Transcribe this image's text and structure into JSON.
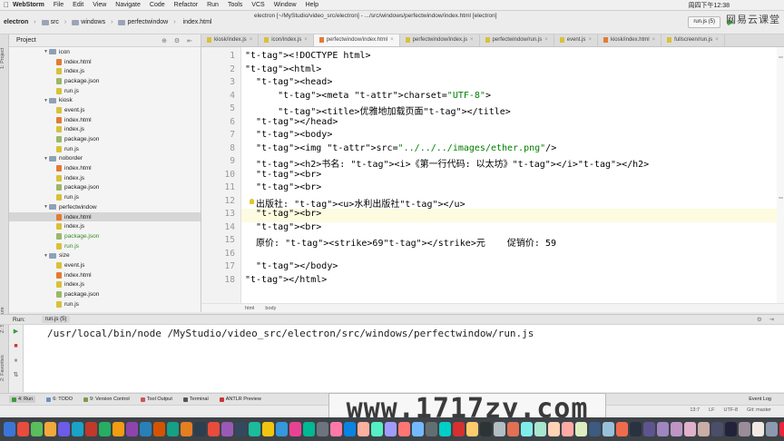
{
  "menubar": {
    "apple": "",
    "app_name": "WebStorm",
    "items": [
      "File",
      "Edit",
      "View",
      "Navigate",
      "Code",
      "Refactor",
      "Run",
      "Tools",
      "VCS",
      "Window",
      "Help"
    ],
    "clock": "周四下午12:38"
  },
  "window_title": "electron [~/MyStudio/video_src/electron] - .../src/windows/perfectwindow/index.html [electron]",
  "logo": "网易云课堂",
  "navbar": {
    "crumbs": [
      "electron",
      "src",
      "windows",
      "perfectwindow",
      "index.html"
    ],
    "run_config": "run.js (5)"
  },
  "left_strip": {
    "project": "1: Project",
    "structure": "Z: Structure",
    "favorites": "2: Favorites"
  },
  "project": {
    "title": "Project",
    "tree": [
      {
        "label": "icon",
        "kind": "folder"
      },
      {
        "label": "index.html",
        "kind": "html"
      },
      {
        "label": "index.js",
        "kind": "js"
      },
      {
        "label": "package.json",
        "kind": "json"
      },
      {
        "label": "run.js",
        "kind": "js"
      },
      {
        "label": "kiosk",
        "kind": "folder"
      },
      {
        "label": "event.js",
        "kind": "js"
      },
      {
        "label": "index.html",
        "kind": "html"
      },
      {
        "label": "index.js",
        "kind": "js"
      },
      {
        "label": "package.json",
        "kind": "json"
      },
      {
        "label": "run.js",
        "kind": "js"
      },
      {
        "label": "noborder",
        "kind": "folder"
      },
      {
        "label": "index.html",
        "kind": "html"
      },
      {
        "label": "index.js",
        "kind": "js"
      },
      {
        "label": "package.json",
        "kind": "json"
      },
      {
        "label": "run.js",
        "kind": "js"
      },
      {
        "label": "perfectwindow",
        "kind": "folder"
      },
      {
        "label": "index.html",
        "kind": "html",
        "selected": true
      },
      {
        "label": "index.js",
        "kind": "js"
      },
      {
        "label": "package.json",
        "kind": "json",
        "green": true
      },
      {
        "label": "run.js",
        "kind": "js",
        "green": true
      },
      {
        "label": "size",
        "kind": "folder"
      },
      {
        "label": "event.js",
        "kind": "js"
      },
      {
        "label": "index.html",
        "kind": "html"
      },
      {
        "label": "index.js",
        "kind": "js"
      },
      {
        "label": "package.json",
        "kind": "json"
      },
      {
        "label": "run.js",
        "kind": "js"
      }
    ]
  },
  "tabs": [
    {
      "label": "kiosk/index.js"
    },
    {
      "label": "icon/index.js"
    },
    {
      "label": "perfectwindow/index.html",
      "active": true
    },
    {
      "label": "perfectwindow/index.js"
    },
    {
      "label": "perfectwindow/run.js"
    },
    {
      "label": "event.js"
    },
    {
      "label": "kiosk/index.html"
    },
    {
      "label": "fullscreen/run.js"
    }
  ],
  "editor": {
    "line_numbers": [
      "1",
      "2",
      "3",
      "4",
      "5",
      "6",
      "7",
      "8",
      "9",
      "10",
      "11",
      "12",
      "13",
      "14",
      "15",
      "16",
      "17",
      "18"
    ],
    "lines": [
      "<!DOCTYPE html>",
      "<html>",
      "  <head>",
      "      <meta charset=\"UTF-8\">",
      "      <title>优雅地加载页面</title>",
      "  </head>",
      "  <body>",
      "  <img src=\"../../../images/ether.png\"/>",
      "  <h2>书名: <i>《第一行代码: 以太坊》</i></h2>",
      "  <br>",
      "  <br>",
      "  出版社: <u>水利出版社</u>",
      "  <br>",
      "  <br>",
      "  原价: <strike>69</strike>元    促销价: 59",
      "",
      "  </body>",
      "</html>"
    ],
    "breadcrumb": [
      "html",
      "body"
    ]
  },
  "run_panel": {
    "label": "Run:",
    "tab": "run.js (5)",
    "command": "/usr/local/bin/node /MyStudio/video_src/electron/src/windows/perfectwindow/run.js"
  },
  "toolwindows": [
    "4: Run",
    "6: TODO",
    "9: Version Control",
    "Tool Output",
    "Terminal",
    "ANTLR Preview"
  ],
  "event_log": "Event Log",
  "status": {
    "position": "13:7",
    "line_sep": "LF",
    "encoding": "UTF-8",
    "git": "Git: master"
  },
  "watermark": "www.1717zy.com",
  "colors": {
    "accent": "#3c9a3c",
    "html_icon": "#e37b34",
    "js_icon": "#d8c13a",
    "json_icon": "#9ab86a"
  }
}
